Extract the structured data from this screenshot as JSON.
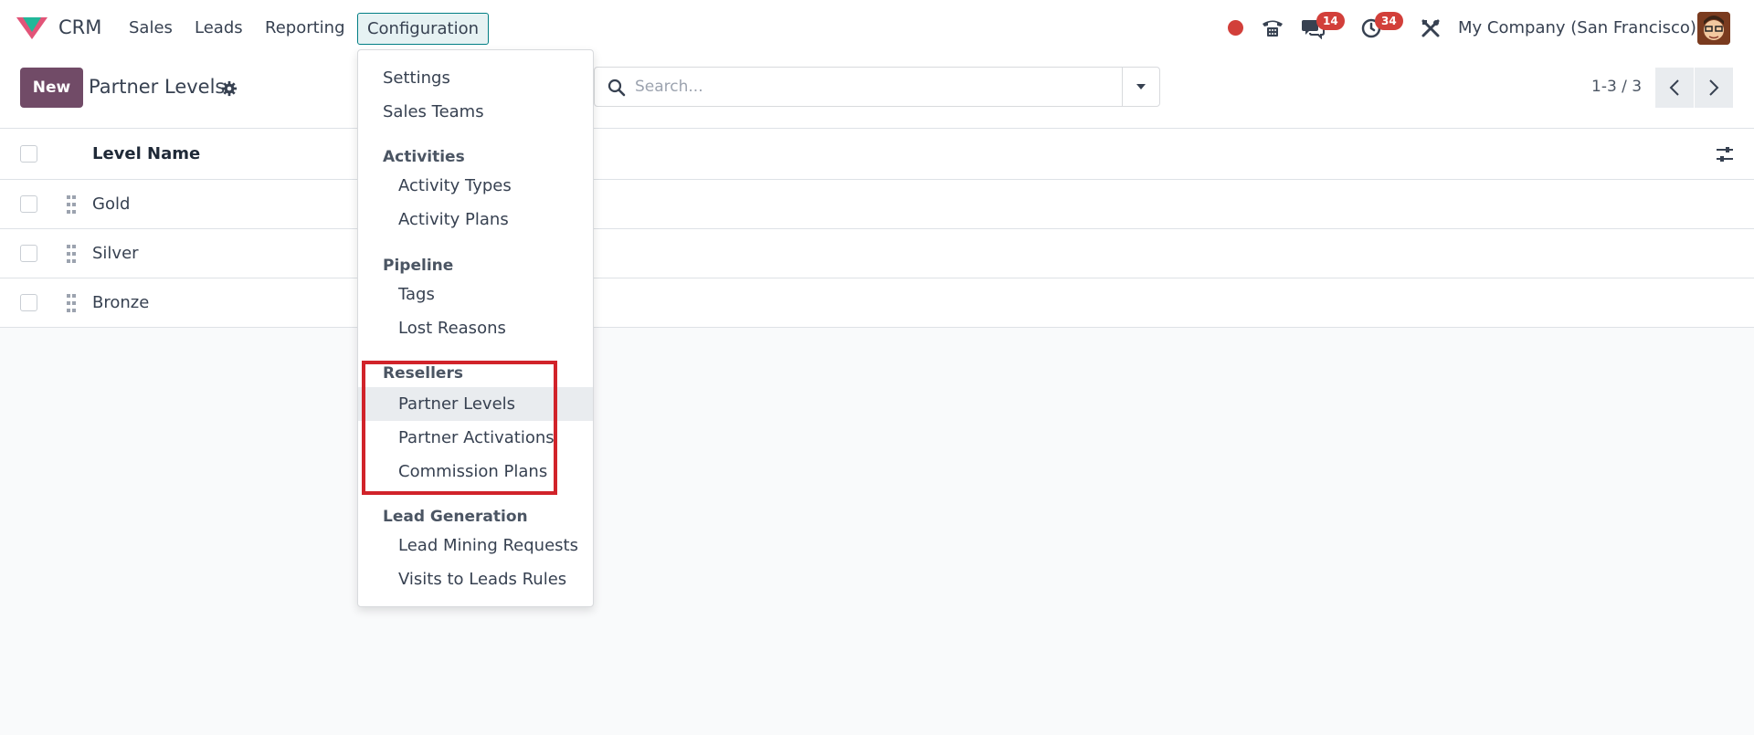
{
  "navbar": {
    "app_name": "CRM",
    "menu": [
      "Sales",
      "Leads",
      "Reporting"
    ],
    "active_menu": "Configuration",
    "messages_count": "14",
    "activities_count": "34",
    "company": "My Company (San Francisco)"
  },
  "control_panel": {
    "new_label": "New",
    "title": "Partner Levels",
    "search_placeholder": "Search...",
    "pager": "1-3 / 3"
  },
  "list": {
    "column": "Level Name",
    "rows": [
      "Gold",
      "Silver",
      "Bronze"
    ]
  },
  "config_menu": {
    "settings": "Settings",
    "sales_teams": "Sales Teams",
    "activities": {
      "title": "Activities",
      "items": [
        "Activity Types",
        "Activity Plans"
      ]
    },
    "pipeline": {
      "title": "Pipeline",
      "items": [
        "Tags",
        "Lost Reasons"
      ]
    },
    "resellers": {
      "title": "Resellers",
      "items": [
        "Partner Levels",
        "Partner Activations",
        "Commission Plans"
      ]
    },
    "lead_generation": {
      "title": "Lead Generation",
      "items": [
        "Lead Mining Requests",
        "Visits to Leads Rules"
      ]
    }
  },
  "colors": {
    "brand": "#714b67",
    "accent": "#017e84",
    "badge": "#d23f3a",
    "highlight": "#d1232a"
  }
}
